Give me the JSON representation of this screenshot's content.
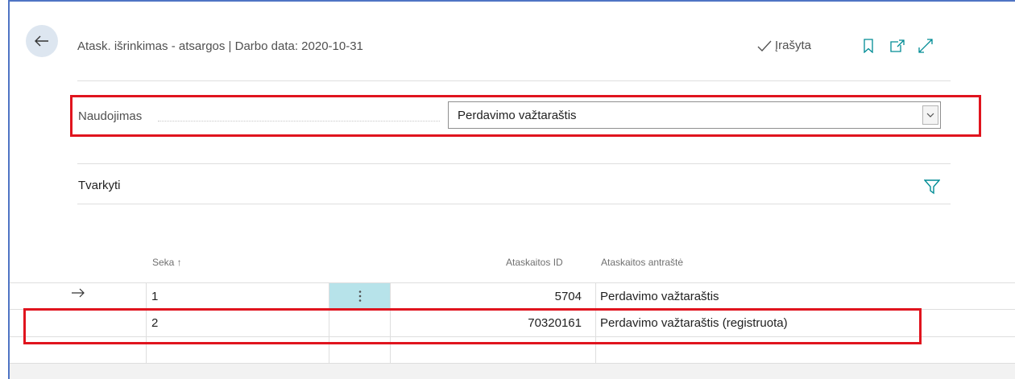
{
  "header": {
    "title": "Atask. išrinkimas - atsargos | Darbo data: 2020-10-31",
    "status": "Įrašyta",
    "icons": [
      "back-arrow-icon",
      "checkmark-icon",
      "bookmark-icon",
      "open-new-window-icon",
      "expand-icon"
    ]
  },
  "field": {
    "label": "Naudojimas",
    "value": "Perdavimo važtaraštis"
  },
  "section": {
    "title": "Tvarkyti",
    "filter_icon": "filter-icon"
  },
  "table": {
    "columns": [
      "Seka ↑",
      "Ataskaitos ID",
      "Ataskaitos antraštė"
    ],
    "rows": [
      {
        "seka": "1",
        "id": "5704",
        "title": "Perdavimo važtaraštis"
      },
      {
        "seka": "2",
        "id": "70320161",
        "title": "Perdavimo važtaraštis (registruota)"
      }
    ]
  },
  "colors": {
    "highlight": "#e0141e",
    "accent": "#008c95",
    "selected_cell": "#b7e3ea",
    "back_button_bg": "#dde6f0"
  }
}
